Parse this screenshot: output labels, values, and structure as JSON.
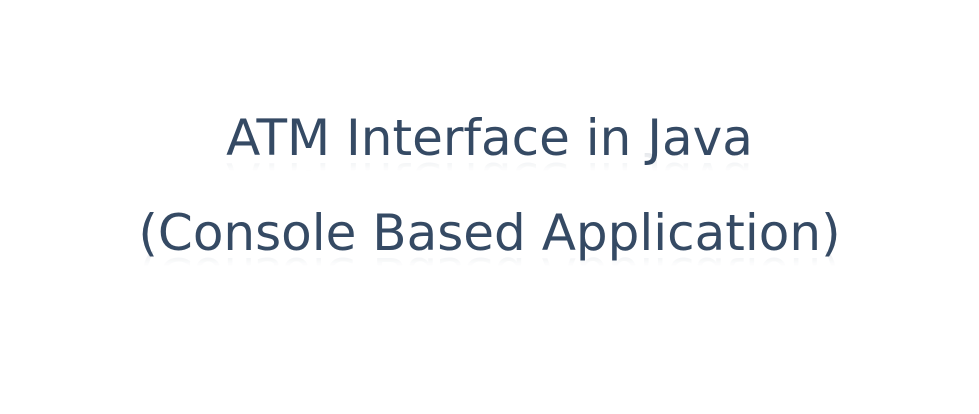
{
  "heading": {
    "line1": "ATM Interface in Java",
    "line2": "(Console Based Application)"
  },
  "colors": {
    "text": "#354a64",
    "background": "#ffffff"
  }
}
